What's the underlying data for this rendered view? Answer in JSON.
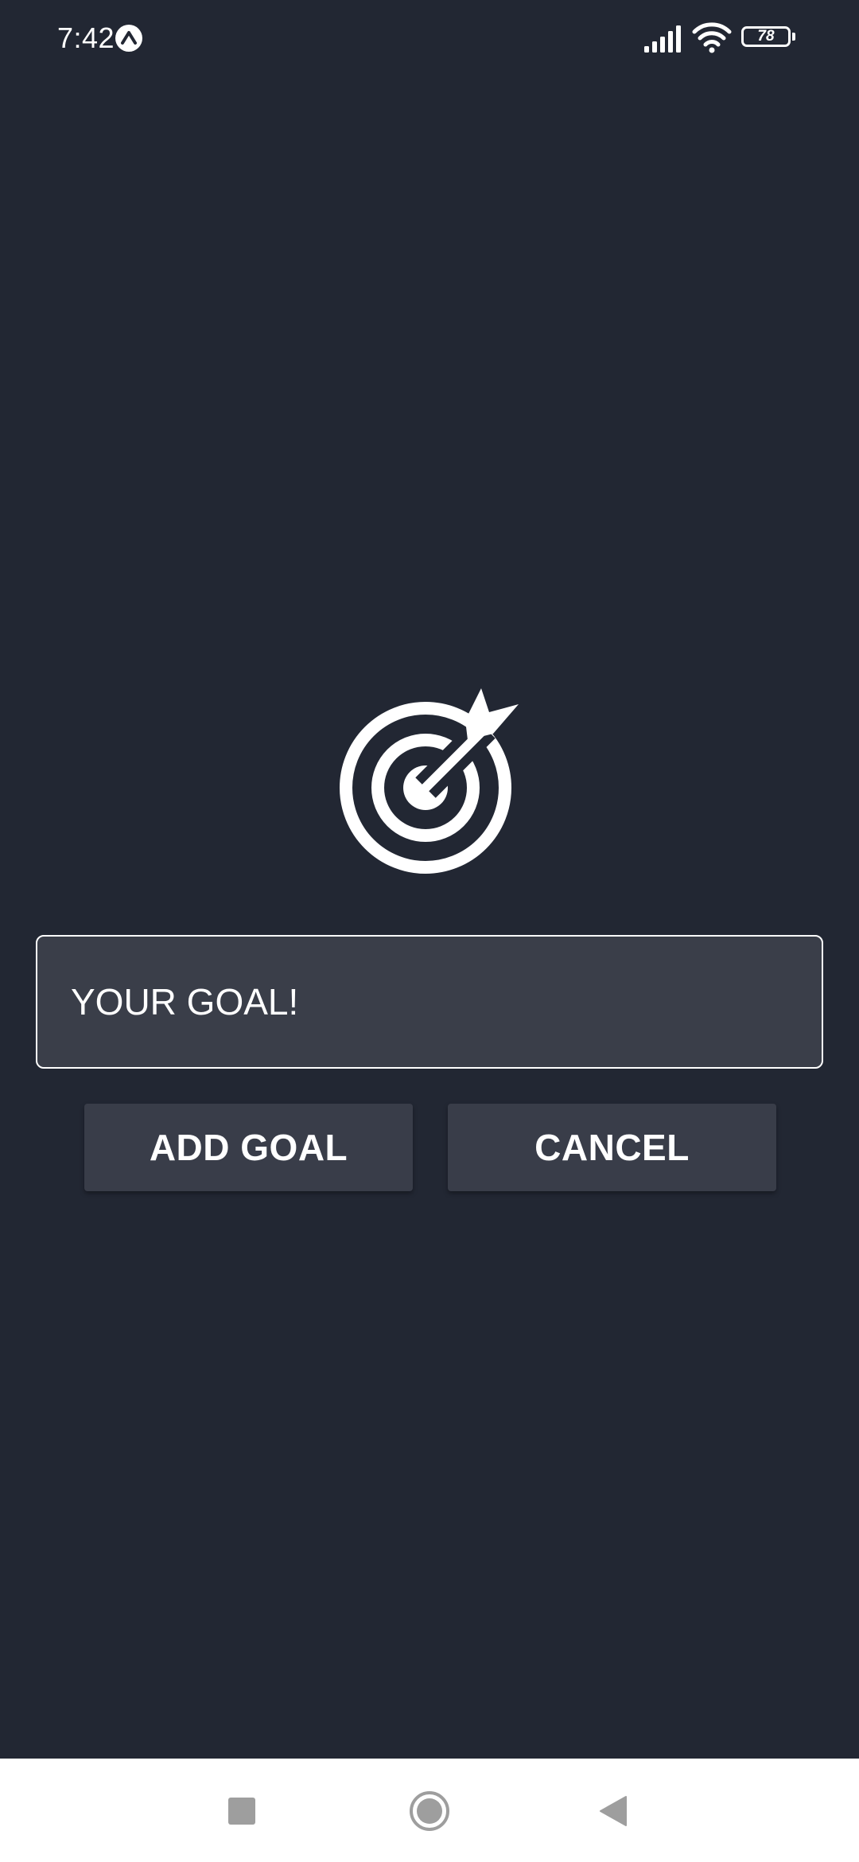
{
  "status_bar": {
    "time": "7:42",
    "app_badge_icon": "expo-badge-icon",
    "signal_icon": "cellular-signal-icon",
    "wifi_icon": "wifi-icon",
    "battery_level": "78"
  },
  "main": {
    "goal_icon": "target-arrow-icon",
    "goal_input": {
      "value": "",
      "placeholder": "YOUR GOAL!"
    },
    "add_button_label": "ADD GOAL",
    "cancel_button_label": "CANCEL"
  },
  "nav_bar": {
    "recents_icon": "square-recents-icon",
    "home_icon": "circle-home-icon",
    "back_icon": "triangle-back-icon"
  },
  "colors": {
    "background": "#222733",
    "input_background": "#3a3e49",
    "button_background": "#393d49",
    "text": "#ffffff",
    "nav_background": "#ffffff",
    "nav_icon": "#9e9e9e"
  }
}
